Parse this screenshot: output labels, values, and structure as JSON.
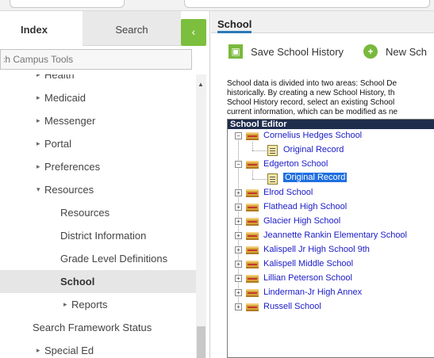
{
  "left_panel": {
    "tabs": {
      "index": "Index",
      "search": "Search"
    },
    "collapse_icon": "chevron-left-icon",
    "search_placeholder": "Search Campus Tools",
    "nav": [
      {
        "label": "Health",
        "arrow": "▸"
      },
      {
        "label": "Medicaid",
        "arrow": "▸"
      },
      {
        "label": "Messenger",
        "arrow": "▸"
      },
      {
        "label": "Portal",
        "arrow": "▸"
      },
      {
        "label": "Preferences",
        "arrow": "▸"
      },
      {
        "label": "Resources",
        "arrow": "▾"
      },
      {
        "label": "Resources",
        "arrow": ""
      },
      {
        "label": "District Information",
        "arrow": ""
      },
      {
        "label": "Grade Level Definitions",
        "arrow": ""
      },
      {
        "label": "School",
        "arrow": ""
      },
      {
        "label": "Reports",
        "arrow": "▸"
      },
      {
        "label": "Search Framework Status",
        "arrow": ""
      },
      {
        "label": "Special Ed",
        "arrow": "▸"
      }
    ]
  },
  "right_panel": {
    "tab": "School",
    "toolbar": {
      "save_label": "Save School History",
      "new_label": "New Sch"
    },
    "description": [
      "School data is divided into two areas: School De",
      "historically. By creating a new School History, th",
      "School History record, select an existing School",
      "current information, which can be modified as ne"
    ],
    "editor": {
      "title": "School Editor",
      "tree": [
        {
          "label": "Cornelius Hedges School",
          "expanded": true,
          "record": "Original Record"
        },
        {
          "label": "Edgerton School",
          "expanded": true,
          "record": "Original Record",
          "record_selected": true
        },
        {
          "label": "Elrod School",
          "expanded": false
        },
        {
          "label": "Flathead High School",
          "expanded": false
        },
        {
          "label": "Glacier High School",
          "expanded": false
        },
        {
          "label": "Jeannette Rankin Elementary School",
          "expanded": false
        },
        {
          "label": "Kalispell Jr High School 9th",
          "expanded": false
        },
        {
          "label": "Kalispell Middle School",
          "expanded": false
        },
        {
          "label": "Lillian Peterson School",
          "expanded": false
        },
        {
          "label": "Linderman-Jr High Annex",
          "expanded": false
        },
        {
          "label": "Russell School",
          "expanded": false
        }
      ]
    }
  },
  "colors": {
    "accent_green": "#79b93c",
    "header_navy": "#1f2d4d",
    "link_blue": "#1a1ac8",
    "selection_blue": "#1f6fe0"
  }
}
